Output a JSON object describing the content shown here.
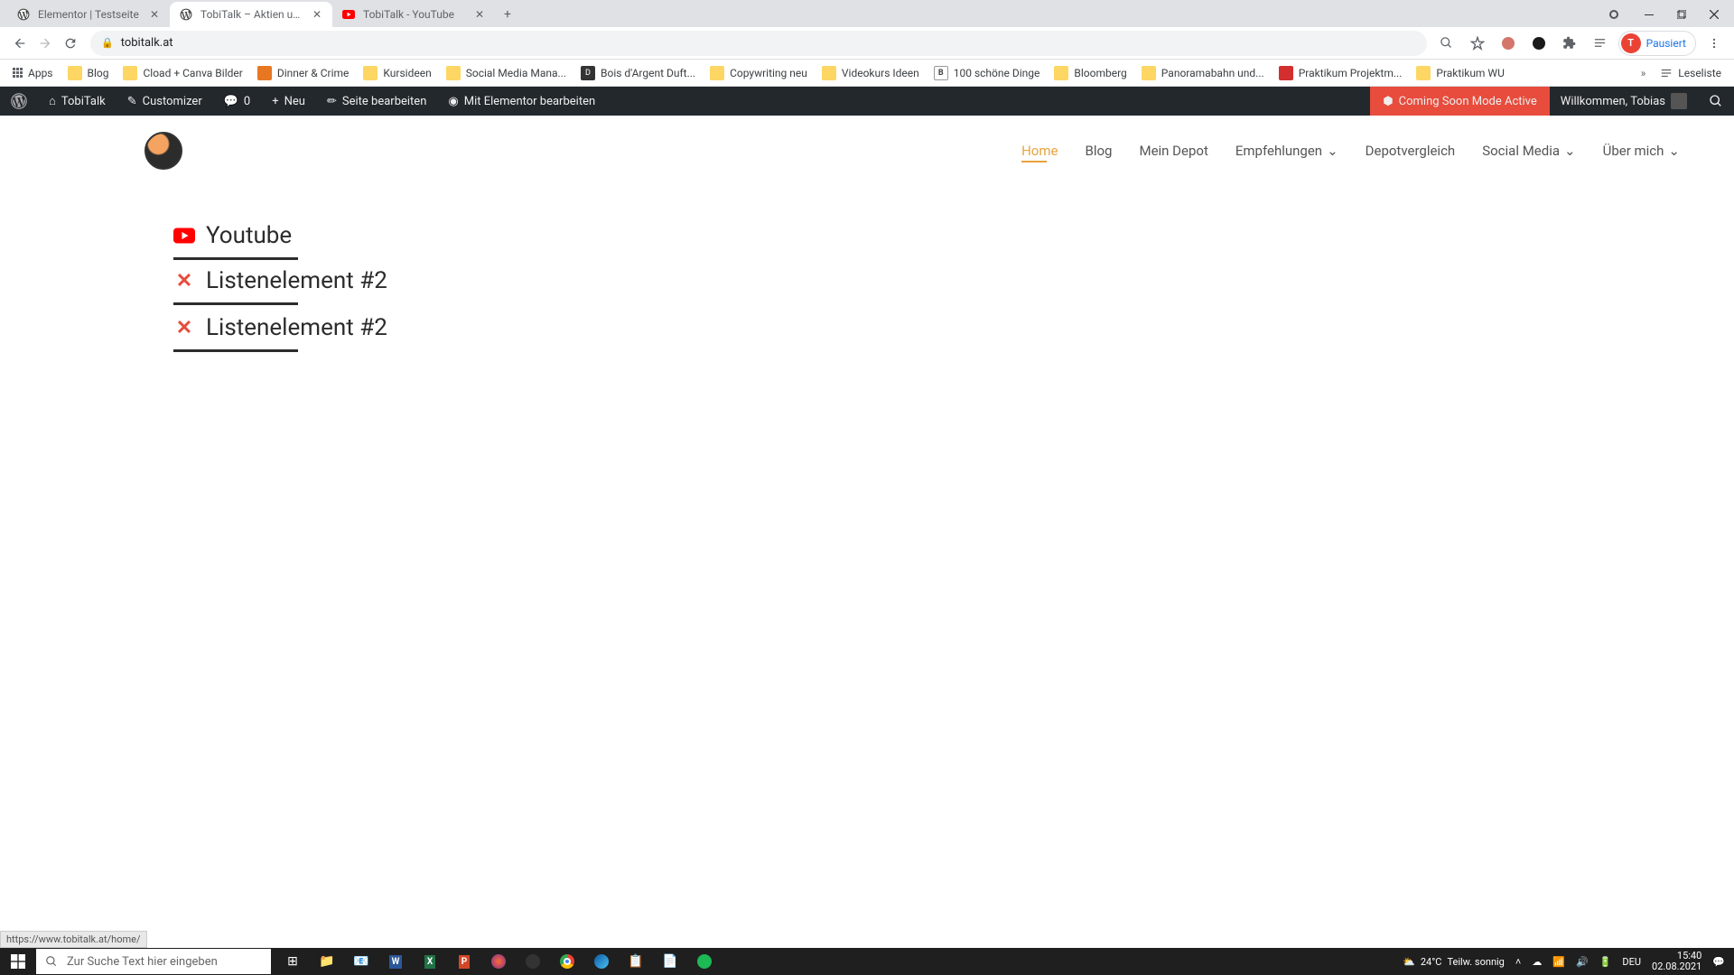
{
  "browser": {
    "tabs": [
      {
        "label": "Elementor | Testseite",
        "favicon": "wp"
      },
      {
        "label": "TobiTalk – Aktien und persönlich...",
        "favicon": "wp",
        "active": true
      },
      {
        "label": "TobiTalk - YouTube",
        "favicon": "yt"
      }
    ],
    "url": "tobitalk.at",
    "profile_letter": "T",
    "profile_status": "Pausiert",
    "bookmarks": [
      "Apps",
      "Blog",
      "Cload + Canva Bilder",
      "Dinner & Crime",
      "Kursideen",
      "Social Media Mana...",
      "Bois d'Argent Duft...",
      "Copywriting neu",
      "Videokurs Ideen",
      "100 schöne Dinge",
      "Bloomberg",
      "Panoramabahn und...",
      "Praktikum Projektm...",
      "Praktikum WU"
    ],
    "reading_list": "Leseliste"
  },
  "wp_admin": {
    "site_name": "TobiTalk",
    "customizer": "Customizer",
    "comments": "0",
    "new": "Neu",
    "edit_page": "Seite bearbeiten",
    "edit_elementor": "Mit Elementor bearbeiten",
    "coming_soon": "Coming Soon Mode Active",
    "welcome": "Willkommen, Tobias"
  },
  "site_nav": {
    "items": [
      {
        "label": "Home",
        "active": true
      },
      {
        "label": "Blog"
      },
      {
        "label": "Mein Depot"
      },
      {
        "label": "Empfehlungen",
        "dropdown": true
      },
      {
        "label": "Depotvergleich"
      },
      {
        "label": "Social Media",
        "dropdown": true
      },
      {
        "label": "Über mich",
        "dropdown": true
      }
    ]
  },
  "content": {
    "items": [
      {
        "icon": "youtube",
        "label": "Youtube"
      },
      {
        "icon": "x",
        "label": "Listenelement #2"
      },
      {
        "icon": "x",
        "label": "Listenelement #2"
      }
    ]
  },
  "status_link": "https://www.tobitalk.at/home/",
  "taskbar": {
    "search_placeholder": "Zur Suche Text hier eingeben",
    "weather_temp": "24°C",
    "weather_desc": "Teilw. sonnig",
    "time": "15:40",
    "date": "02.08.2021",
    "lang": "DEU"
  }
}
